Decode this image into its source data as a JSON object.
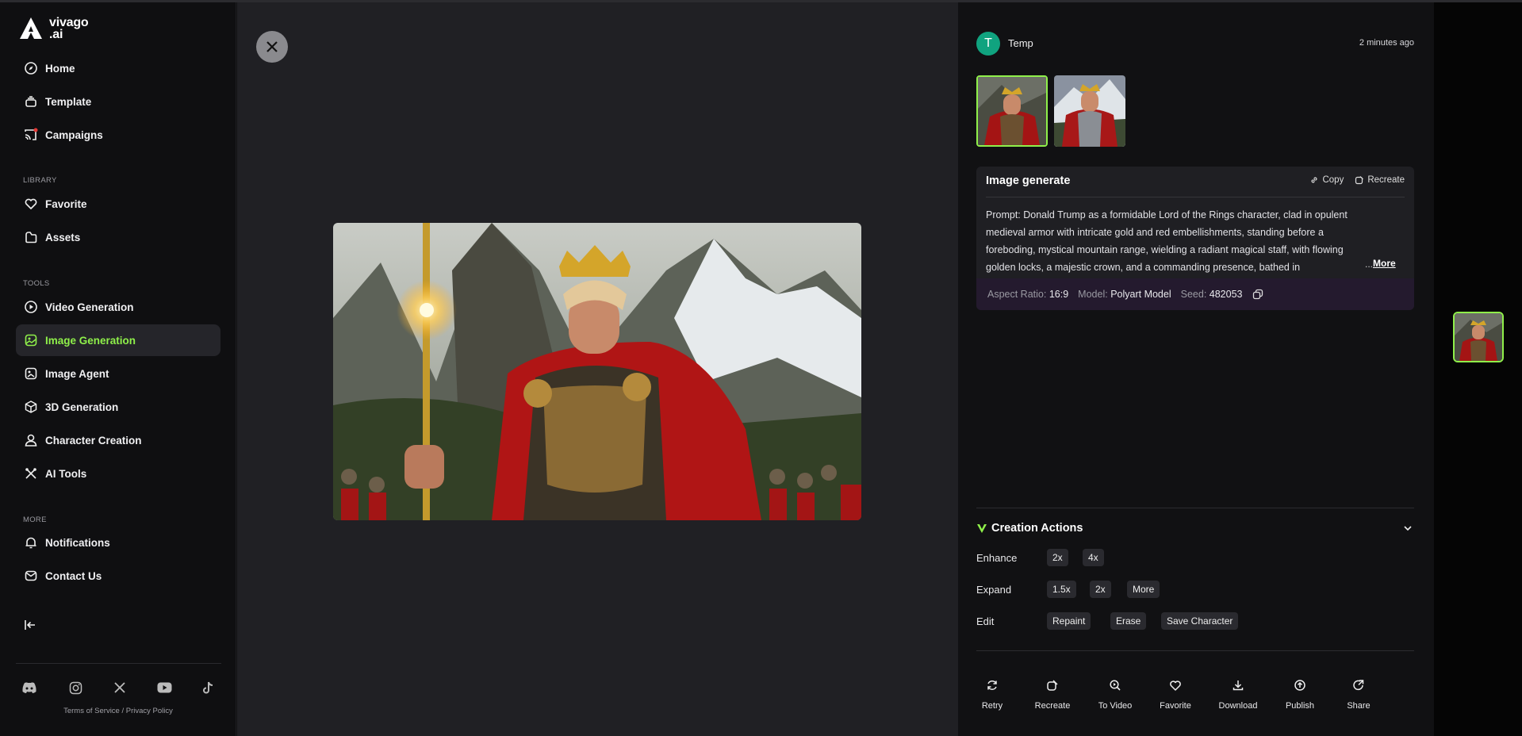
{
  "brand": {
    "name_line1": "vivago",
    "name_line2": ".ai"
  },
  "sidebar": {
    "main_items": [
      {
        "label": "Home",
        "icon": "compass-icon"
      },
      {
        "label": "Template",
        "icon": "template-icon"
      },
      {
        "label": "Campaigns",
        "icon": "cast-icon"
      }
    ],
    "library_label": "LIBRARY",
    "library_items": [
      {
        "label": "Favorite",
        "icon": "heart-icon"
      },
      {
        "label": "Assets",
        "icon": "folder-icon"
      }
    ],
    "tools_label": "TOOLS",
    "tools_items": [
      {
        "label": "Video Generation",
        "icon": "play-icon"
      },
      {
        "label": "Image Generation",
        "icon": "image-icon",
        "active": true
      },
      {
        "label": "Image Agent",
        "icon": "image-agent-icon"
      },
      {
        "label": "3D Generation",
        "icon": "cube-icon"
      },
      {
        "label": "Character Creation",
        "icon": "user-icon"
      },
      {
        "label": "AI Tools",
        "icon": "tools-icon"
      }
    ],
    "more_label": "MORE",
    "more_items": [
      {
        "label": "Notifications",
        "icon": "bell-icon"
      },
      {
        "label": "Contact Us",
        "icon": "mail-icon"
      }
    ],
    "social": [
      "discord-icon",
      "instagram-icon",
      "x-icon",
      "youtube-icon",
      "tiktok-icon"
    ],
    "terms": "Terms of Service",
    "slash": "/",
    "privacy": "Privacy Policy"
  },
  "colors": {
    "accent": "#8ff04a",
    "avatar": "#10a37f",
    "meta_bg": "#241a2e"
  },
  "detail": {
    "user": {
      "initial": "T",
      "name": "Temp"
    },
    "timestamp": "2 minutes ago",
    "card": {
      "title": "Image generate",
      "copy_label": "Copy",
      "recreate_label": "Recreate",
      "prompt": "Prompt: Donald Trump as a formidable Lord of the Rings character, clad in opulent medieval armor with intricate gold and red embellishments, standing before a foreboding, mystical mountain range, wielding a radiant magical staff, with flowing golden locks, a majestic crown, and a commanding presence, bathed in",
      "ellipsis": "...",
      "more_label": "More",
      "aspect_label": "Aspect Ratio:",
      "aspect_value": "16:9",
      "model_label": "Model:",
      "model_value": "Polyart Model",
      "seed_label": "Seed:",
      "seed_value": "482053"
    },
    "creation_actions": {
      "title": "Creation Actions",
      "enhance_label": "Enhance",
      "enhance_options": [
        "2x",
        "4x"
      ],
      "expand_label": "Expand",
      "expand_options": [
        "1.5x",
        "2x",
        "More"
      ],
      "edit_label": "Edit",
      "edit_options": [
        "Repaint",
        "Erase",
        "Save Character"
      ]
    },
    "actions": [
      "Retry",
      "Recreate",
      "To Video",
      "Favorite",
      "Download",
      "Publish",
      "Share"
    ]
  }
}
